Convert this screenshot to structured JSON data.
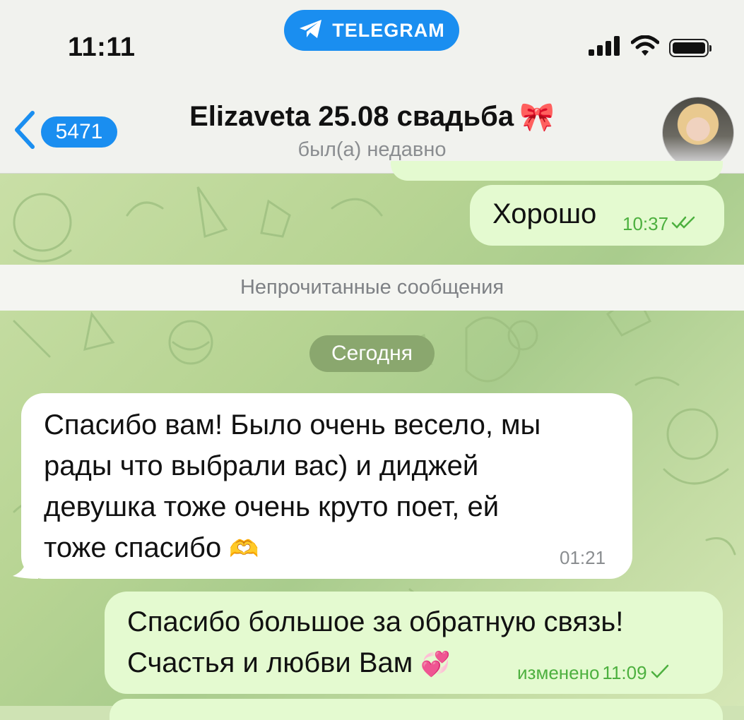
{
  "status_bar": {
    "time": "11:11",
    "app_pill": "TELEGRAM"
  },
  "header": {
    "back_count": "5471",
    "title": "Elizaveta 25.08 свадьба",
    "title_emoji": "🎀",
    "status": "был(а) недавно"
  },
  "messages": {
    "first": {
      "text": "Хорошо",
      "time": "10:37"
    },
    "unread_separator": "Непрочитанные сообщения",
    "date_label": "Сегодня",
    "incoming": {
      "lines": [
        "Спасибо вам! Было очень весело, мы",
        "рады что выбрали вас) и диджей",
        "девушка тоже очень круто поет, ей",
        "тоже спасибо"
      ],
      "emoji": "🫶",
      "time": "01:21"
    },
    "reply": {
      "lines": [
        "Спасибо большое за обратную связь!",
        "Счастья и любви Вам"
      ],
      "emoji": "💞",
      "edited_label": "изменено",
      "time": "11:09"
    }
  },
  "colors": {
    "accent": "#1a8ef0",
    "outgoing_bubble": "#e4fad0",
    "incoming_bubble": "#ffffff",
    "check": "#4db03f",
    "chat_wallpaper": "#b7d493"
  }
}
